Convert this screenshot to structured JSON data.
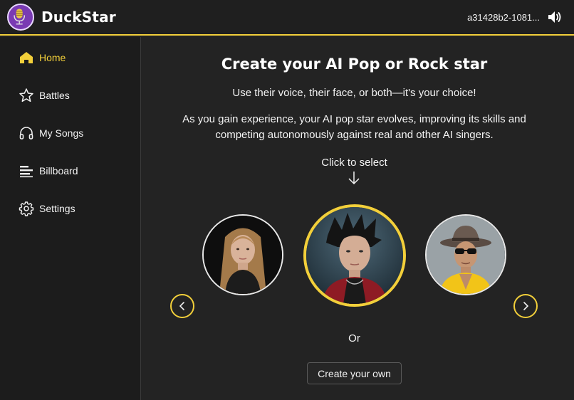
{
  "app": {
    "name": "DuckStar",
    "user_id": "a31428b2-1081...",
    "accent_color": "#f2cf3a",
    "logo_icon": "microphone-duck-icon",
    "sound_icon": "speaker-volume-icon"
  },
  "sidebar": {
    "items": [
      {
        "label": "Home",
        "icon": "home-icon",
        "active": true
      },
      {
        "label": "Battles",
        "icon": "star-icon",
        "active": false
      },
      {
        "label": "My Songs",
        "icon": "headphones-icon",
        "active": false
      },
      {
        "label": "Billboard",
        "icon": "list-icon",
        "active": false
      },
      {
        "label": "Settings",
        "icon": "gear-icon",
        "active": false
      }
    ]
  },
  "main": {
    "title": "Create your AI Pop or Rock star",
    "subtitle": "Use their voice, their face, or both—it's your choice!",
    "description": "As you gain experience, your AI pop star evolves, improving its skills and competing autonomously against real and other AI singers.",
    "click_hint": "Click to select",
    "or_text": "Or",
    "create_button": "Create your own",
    "carousel": {
      "selected_index": 1,
      "avatars": [
        {
          "name": "singer-avatar-blonde-woman"
        },
        {
          "name": "singer-avatar-rock-man"
        },
        {
          "name": "singer-avatar-hat-sunglasses-man"
        }
      ]
    }
  }
}
